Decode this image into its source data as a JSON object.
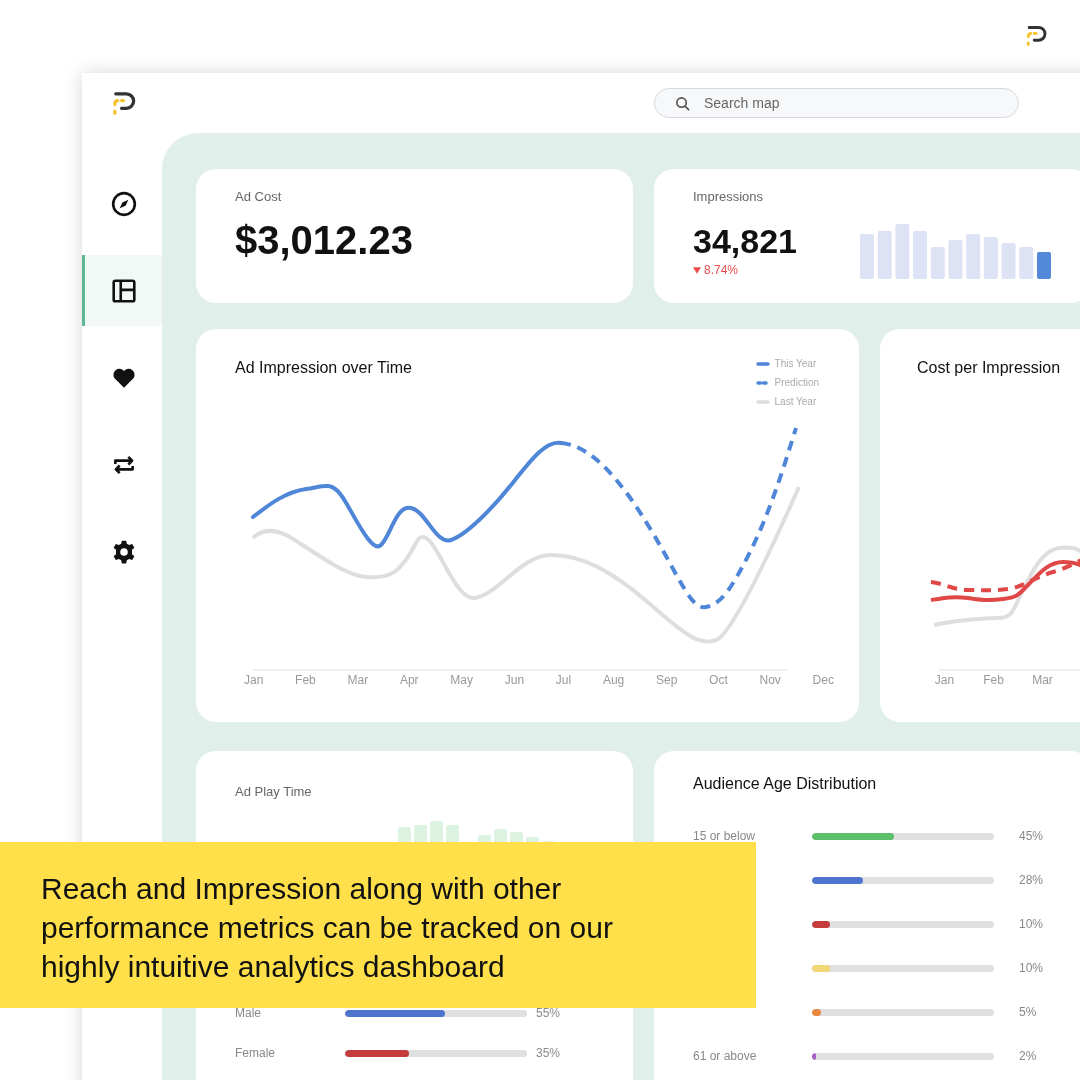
{
  "search": {
    "placeholder": "Search map"
  },
  "sidebar": {
    "items": [
      {
        "selected": false
      },
      {
        "selected": true
      },
      {
        "selected": false
      },
      {
        "selected": false
      },
      {
        "selected": false
      }
    ]
  },
  "ad_cost": {
    "label": "Ad Cost",
    "value": "$3,012.23"
  },
  "impressions": {
    "label": "Impressions",
    "value": "34,821",
    "change": "8.74%",
    "decreasing": true
  },
  "impression_chart": {
    "title": "Ad Impression over Time",
    "legend": [
      {
        "label": "This Year",
        "kind": "solid"
      },
      {
        "label": "Prediction",
        "kind": "dashed"
      },
      {
        "label": "Last Year",
        "kind": "muted"
      }
    ],
    "months": [
      "Jan",
      "Feb",
      "Mar",
      "Apr",
      "May",
      "Jun",
      "Jul",
      "Aug",
      "Sep",
      "Oct",
      "Nov",
      "Dec"
    ]
  },
  "cost_chart": {
    "title": "Cost per Impression",
    "months": [
      "Jan",
      "Feb",
      "Mar"
    ]
  },
  "play_time": {
    "label": "Ad Play Time",
    "genders": [
      {
        "label": "Male",
        "level": 0.55,
        "reading": "55%",
        "color": "#4f74d0"
      },
      {
        "label": "Female",
        "level": 0.35,
        "reading": "35%",
        "color": "#c43c3c"
      }
    ]
  },
  "age_distribution": {
    "title": "Audience Age Distribution",
    "groups": [
      {
        "label": "15 or below",
        "level": 0.45,
        "reading": "45%",
        "color": "#5cbf6a"
      },
      {
        "level": 0.28,
        "reading": "28%",
        "color": "#4f74d0"
      },
      {
        "level": 0.1,
        "reading": "10%",
        "color": "#c43c3c"
      },
      {
        "level": 0.1,
        "reading": "10%",
        "color": "#f1d675"
      },
      {
        "level": 0.05,
        "reading": "5%",
        "color": "#e9883f"
      },
      {
        "label": "61 or above",
        "level": 0.02,
        "reading": "2%",
        "color": "#a45fc4"
      }
    ]
  },
  "banner": {
    "text": "Reach and Impression along with other performance metrics can be tracked on our highly intuitive analytics dashboard"
  }
}
